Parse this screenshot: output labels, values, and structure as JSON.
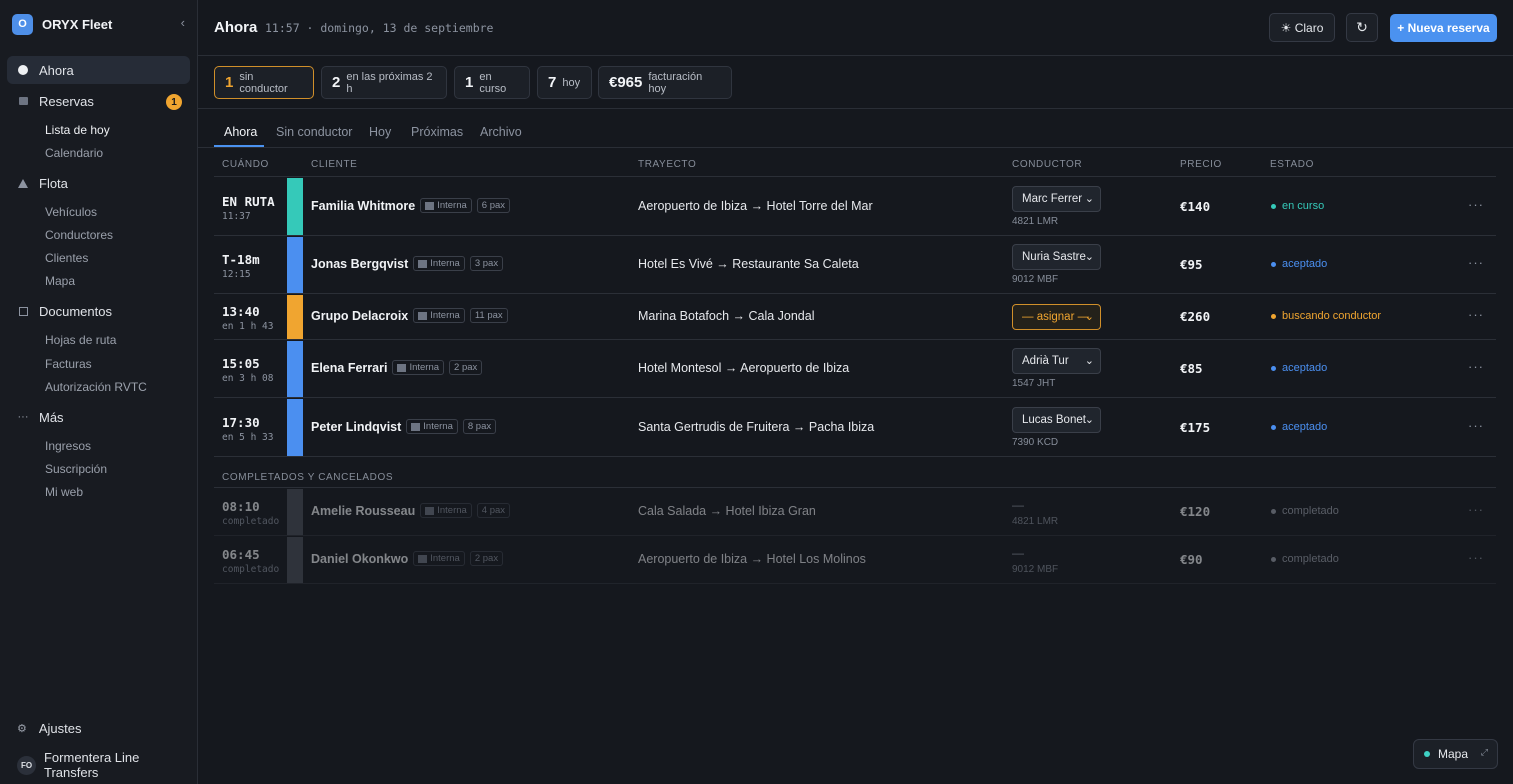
{
  "app": {
    "logo_letter": "O",
    "name": "ORYX Fleet",
    "collapse_icon": "‹"
  },
  "sidebar": {
    "nav": [
      {
        "label": "Ahora",
        "icon": "dot-icon"
      },
      {
        "label": "Reservas",
        "icon": "calendar-icon",
        "badge": "1"
      },
      {
        "label": "Flota",
        "icon": "triangle-icon"
      },
      {
        "label": "Documentos",
        "icon": "document-icon"
      },
      {
        "label": "Más",
        "icon": "ellipsis-icon"
      }
    ],
    "reservas_sub": [
      "Lista de hoy",
      "Calendario"
    ],
    "flota_sub": [
      "Vehículos",
      "Conductores",
      "Clientes",
      "Mapa"
    ],
    "documentos_sub": [
      "Hojas de ruta",
      "Facturas",
      "Autorización RVTC"
    ],
    "mas_sub": [
      "Ingresos",
      "Suscripción",
      "Mi web"
    ],
    "settings_label": "Ajustes",
    "account_initials": "FO",
    "account_name": "Formentera Line Transfers"
  },
  "header": {
    "title": "Ahora",
    "subtitle": "11:57 · domingo, 13 de septiembre",
    "theme_label": "☀ Claro",
    "refresh_icon": "↻",
    "new_booking_label": "+ Nueva reserva"
  },
  "stats": [
    {
      "value": "1",
      "label": "sin conductor"
    },
    {
      "value": "2",
      "label": "en las próximas 2 h"
    },
    {
      "value": "1",
      "label": "en curso"
    },
    {
      "value": "7",
      "label": "hoy"
    },
    {
      "value": "€965",
      "label": "facturación hoy"
    }
  ],
  "tabs": [
    "Ahora",
    "Sin conductor",
    "Hoy",
    "Próximas",
    "Archivo"
  ],
  "columns": [
    "CUÁNDO",
    "CLIENTE",
    "TRAYECTO",
    "CONDUCTOR",
    "PRECIO",
    "ESTADO"
  ],
  "rows": [
    {
      "when": "EN RUTA",
      "when_sub": "11:37",
      "client": "Familia Whitmore",
      "tag": "Interna",
      "pax": "6 pax",
      "route": "Aeropuerto de Ibiza → Hotel Torre del Mar",
      "driver": "Marc Ferrer",
      "plate": "4821 LMR",
      "price": "€140",
      "status": "en curso",
      "bar_color": "#35c9b9",
      "status_color": "#35c9b9"
    },
    {
      "when": "T-18m",
      "when_sub": "12:15",
      "client": "Jonas Bergqvist",
      "tag": "Interna",
      "pax": "3 pax",
      "route": "Hotel Es Vivé → Restaurante Sa Caleta",
      "driver": "Nuria Sastre",
      "plate": "9012 MBF",
      "price": "€95",
      "status": "aceptado",
      "bar_color": "#4b8ff0",
      "status_color": "#4b8ff0"
    },
    {
      "when": "13:40",
      "when_sub": "en 1 h 43",
      "client": "Grupo Delacroix",
      "tag": "Interna",
      "pax": "11 pax",
      "route": "Marina Botafoch → Cala Jondal",
      "driver": "— asignar —",
      "plate": "",
      "price": "€260",
      "status": "buscando conductor",
      "bar_color": "#f0a530",
      "status_color": "#f0a530"
    },
    {
      "when": "15:05",
      "when_sub": "en 3 h 08",
      "client": "Elena Ferrari",
      "tag": "Interna",
      "pax": "2 pax",
      "route": "Hotel Montesol → Aeropuerto de Ibiza",
      "driver": "Adrià Tur",
      "plate": "1547 JHT",
      "price": "€85",
      "status": "aceptado",
      "bar_color": "#4b8ff0",
      "status_color": "#4b8ff0"
    },
    {
      "when": "17:30",
      "when_sub": "en 5 h 33",
      "client": "Peter Lindqvist",
      "tag": "Interna",
      "pax": "8 pax",
      "route": "Santa Gertrudis de Fruitera → Pacha Ibiza",
      "driver": "Lucas Bonet",
      "plate": "7390 KCD",
      "price": "€175",
      "status": "aceptado",
      "bar_color": "#4b8ff0",
      "status_color": "#4b8ff0"
    }
  ],
  "completed_section_label": "COMPLETADOS Y CANCELADOS",
  "completed_rows": [
    {
      "when": "08:10",
      "when_sub": "completado",
      "client": "Amelie Rousseau",
      "tag": "Interna",
      "pax": "4 pax",
      "route": "Cala Salada → Hotel Ibiza Gran",
      "driver": "—",
      "plate": "4821 LMR",
      "price": "€120",
      "status": "completado"
    },
    {
      "when": "06:45",
      "when_sub": "completado",
      "client": "Daniel Okonkwo",
      "tag": "Interna",
      "pax": "2 pax",
      "route": "Aeropuerto de Ibiza → Hotel Los Molinos",
      "driver": "—",
      "plate": "9012 MBF",
      "price": "€90",
      "status": "completado"
    }
  ],
  "more_label": "···",
  "map_button": {
    "label": "Mapa",
    "expand_icon": "⤢"
  }
}
